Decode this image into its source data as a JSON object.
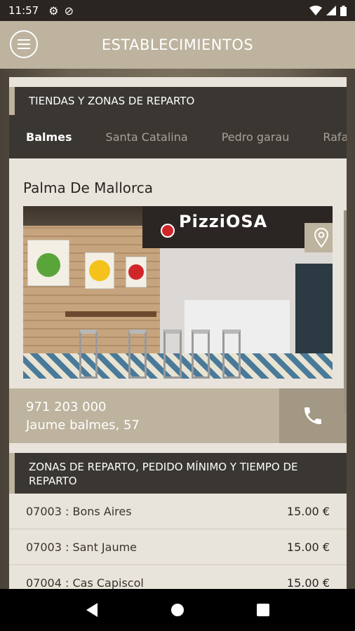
{
  "status_bar": {
    "time": "11:57",
    "icons": [
      "gear-icon",
      "dnd-icon",
      "wifi-icon",
      "signal-icon",
      "battery-icon"
    ]
  },
  "app_bar": {
    "title": "ESTABLECIMIENTOS",
    "menu_icon": "hamburger-icon"
  },
  "stores_section": {
    "header": "TIENDAS Y ZONAS DE REPARTO",
    "tabs": [
      {
        "label": "Balmes",
        "active": true
      },
      {
        "label": "Santa Catalina",
        "active": false
      },
      {
        "label": "Pedro garau",
        "active": false
      },
      {
        "label": "Rafa",
        "active": false
      }
    ]
  },
  "store": {
    "city": "Palma De Mallorca",
    "sign_text": "PizziOSA",
    "phone": "971 203 000",
    "address": "Jaume balmes, 57",
    "map_pin_icon": "location-pin-icon",
    "call_icon": "phone-icon"
  },
  "zones": {
    "header": "ZONAS DE REPARTO, PEDIDO MÍNIMO Y TIEMPO DE REPARTO",
    "rows": [
      {
        "name": "07003 : Bons Aires",
        "price": "15.00 €"
      },
      {
        "name": "07003 : Sant Jaume",
        "price": "15.00 €"
      },
      {
        "name": "07004 : Cas Capiscol",
        "price": "15.00 €"
      }
    ]
  },
  "colors": {
    "accent": "#bdb39e",
    "dark": "#3a3632",
    "card_bg": "#e8e4dc"
  }
}
